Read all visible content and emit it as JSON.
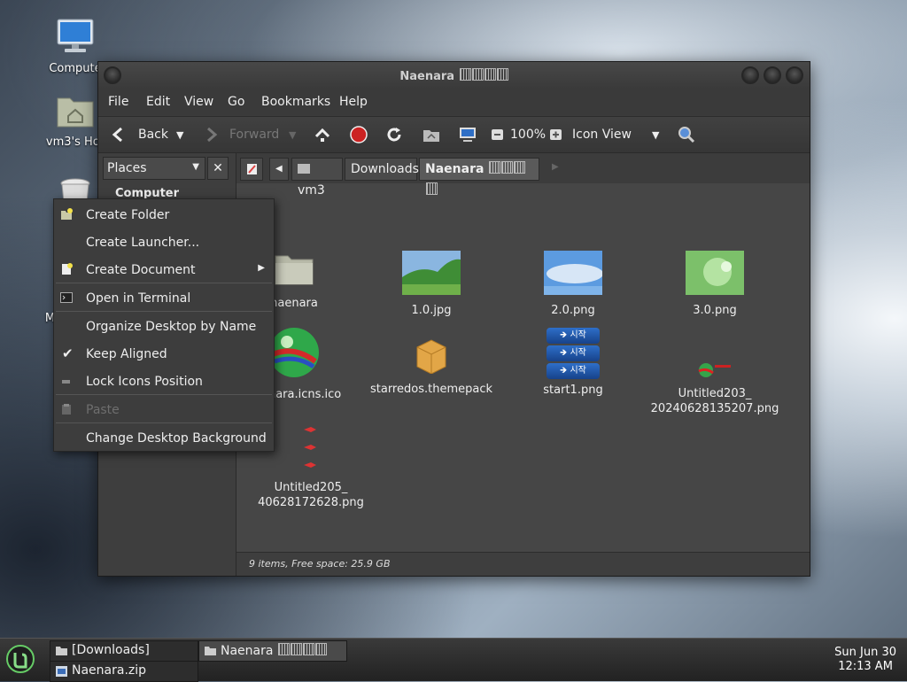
{
  "desktop": {
    "icons": [
      {
        "label": "Compute"
      },
      {
        "label": "vm3's Hor"
      },
      {
        "label": "Mo"
      }
    ]
  },
  "window": {
    "title": "Naenara",
    "menus": [
      "File",
      "Edit",
      "View",
      "Go",
      "Bookmarks",
      "Help"
    ],
    "toolbar": {
      "back": "Back",
      "forward": "Forward",
      "zoom": "100%",
      "view_mode": "Icon View"
    },
    "sidebar": {
      "selector": "Places",
      "heading": "Computer"
    },
    "pathbar": [
      "vm3",
      "Downloads",
      "Naenara"
    ],
    "files": [
      {
        "name": "naenara"
      },
      {
        "name": "1.0.jpg"
      },
      {
        "name": "2.0.png"
      },
      {
        "name": "3.0.png"
      },
      {
        "name": "naenara.icns.ico"
      },
      {
        "name": "starredos.themepack"
      },
      {
        "name": "start1.png"
      },
      {
        "name_line1": "Untitled203_",
        "name_line2": "20240628135207.png"
      },
      {
        "name_line1": "Untitled205_",
        "name_line2": "40628172628.png"
      }
    ],
    "start_label": "시작",
    "status": "9 items, Free space: 25.9 GB"
  },
  "context_menu": {
    "items": [
      {
        "label": "Create Folder",
        "icon": "folder-new-icon"
      },
      {
        "label": "Create Launcher..."
      },
      {
        "label": "Create Document",
        "icon": "document-new-icon"
      },
      {
        "label": "Open in Terminal",
        "icon": "terminal-icon"
      },
      {
        "label": "Organize Desktop by Name"
      },
      {
        "label": "Keep Aligned",
        "checked": true
      },
      {
        "label": "Lock Icons Position"
      },
      {
        "label": "Paste",
        "disabled": true
      },
      {
        "label": "Change Desktop Background"
      }
    ]
  },
  "panel": {
    "tasks": [
      {
        "label": "[Downloads]"
      },
      {
        "label": "Naenara.zip"
      },
      {
        "label": "Naenara"
      }
    ],
    "clock": {
      "date": "Sun Jun 30",
      "time": "12:13 AM"
    }
  }
}
